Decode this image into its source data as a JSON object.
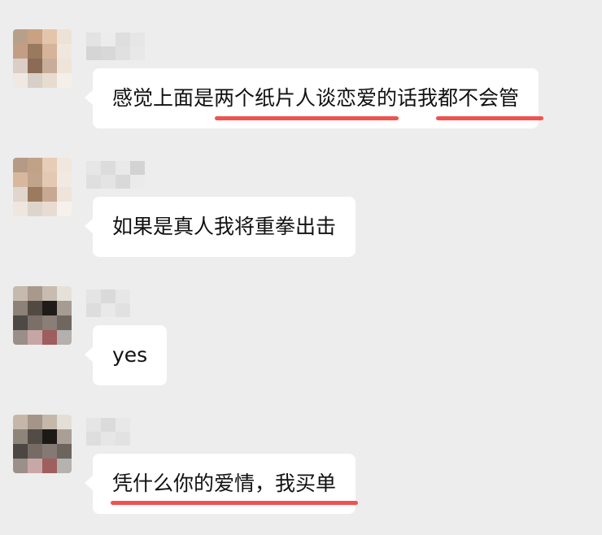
{
  "messages": [
    {
      "text": "感觉上面是两个纸片人谈恋爱的话我都不会管",
      "avatar_colors": [
        "#b7a08a",
        "#c9a283",
        "#e3c5ab",
        "#eee1d6",
        "#c49e84",
        "#9a7a5e",
        "#d6b49a",
        "#f2e7de",
        "#d9cfc6",
        "#8b6b55",
        "#c8ad9a",
        "#efe4da",
        "#f0e8e3",
        "#d7cfc8",
        "#e8dbd0",
        "#f5efea"
      ],
      "name_blur_colors": [
        "#e3e3e3",
        "#ececec",
        "#dedede",
        "#e6e6e6",
        "#d5d5d5",
        "#d8d8d8",
        "#e0e0e0",
        "#e8e8e8"
      ]
    },
    {
      "text": "如果是真人我将重拳出击",
      "avatar_colors": [
        "#b59b86",
        "#c2a287",
        "#e6cdb8",
        "#f1e7de",
        "#d7b89f",
        "#c0a48c",
        "#e3c8b2",
        "#f2e9e2",
        "#e0d6cd",
        "#9b7a5e",
        "#c9a893",
        "#efe4da",
        "#efe6df",
        "#ddd4cc",
        "#e8dcd2",
        "#f7f1ec"
      ],
      "name_blur_colors": [
        "#e6e6e6",
        "#dcdcdc",
        "#e9e9e9",
        "#d3d3d3",
        "#dfdfdf",
        "#e4e4e4",
        "#d9d9d9",
        "#ebebeb"
      ]
    },
    {
      "text": "yes",
      "avatar_colors": [
        "#c6b9ad",
        "#a8998c",
        "#c8bcb0",
        "#e6e0da",
        "#8d8277",
        "#514a43",
        "#1f1b19",
        "#a79c92",
        "#4e4944",
        "#7a6f69",
        "#8a7e77",
        "#6f6760",
        "#9a8e89",
        "#c5a6a4",
        "#9f5d5d",
        "#b3b0ad"
      ],
      "name_blur_colors": [
        "#e4e4e4",
        "#dadada",
        "#e7e7e7",
        "#dddddd",
        "#e9e9e9",
        "#e1e1e1"
      ]
    },
    {
      "text": "凭什么你的爱情，我买单",
      "avatar_colors": [
        "#c4b7aa",
        "#a49588",
        "#c4b8ab",
        "#e4ded8",
        "#8f847a",
        "#534b45",
        "#1d1917",
        "#a99f95",
        "#4c4742",
        "#776c65",
        "#857973",
        "#6c645d",
        "#9b8f8a",
        "#c7a8a6",
        "#a05f5f",
        "#b6b2af"
      ],
      "name_blur_colors": [
        "#e5e5e5",
        "#dbdbdb",
        "#e8e8e8",
        "#dedede",
        "#e6e6e6",
        "#e2e2e2"
      ]
    }
  ],
  "highlight_color": "#f0524f"
}
